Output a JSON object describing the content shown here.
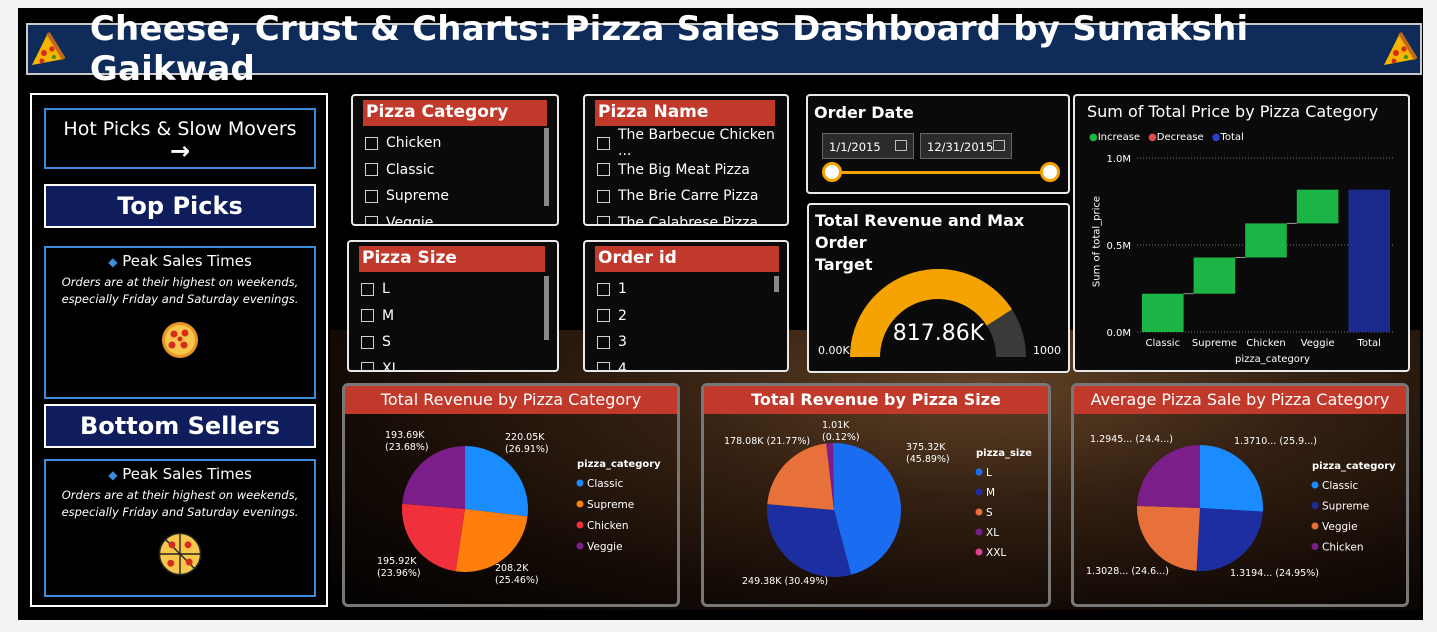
{
  "banner": {
    "title": "Cheese, Crust & Charts: Pizza Sales Dashboard by Sunakshi Gaikwad",
    "left_icon": "pizza-slice-icon",
    "right_icon": "pizza-slice-icon"
  },
  "left_panel": {
    "nav_button": {
      "label": "Hot Picks & Slow Movers",
      "arrow": "→",
      "icon": "arrow-right-icon"
    },
    "top_picks": {
      "title": "Top Picks",
      "info_title": "Peak Sales Times",
      "info_text_1": "Orders are at their highest on weekends,",
      "info_text_2": "especially Friday and Saturday evenings.",
      "icon": "pizza-icon"
    },
    "bottom_sellers": {
      "title": "Bottom Sellers",
      "info_title": "Peak Sales Times",
      "info_text_1": "Orders are at their highest on weekends,",
      "info_text_2": "especially Friday and Saturday evenings.",
      "icon": "pizza-icon"
    }
  },
  "slicers": {
    "category": {
      "title": "Pizza Category",
      "items": [
        "Chicken",
        "Classic",
        "Supreme",
        "Veggie"
      ]
    },
    "name": {
      "title": "Pizza Name",
      "items": [
        "The Barbecue Chicken ...",
        "The Big Meat Pizza",
        "The Brie Carre Pizza",
        "The Calabrese Pizza"
      ]
    },
    "size": {
      "title": "Pizza Size",
      "items": [
        "L",
        "M",
        "S",
        "XL"
      ]
    },
    "order_id": {
      "title": "Order id",
      "items": [
        "1",
        "2",
        "3",
        "4"
      ]
    }
  },
  "order_date": {
    "title": "Order Date",
    "start": "1/1/2015",
    "end": "12/31/2015",
    "icon": "calendar-icon"
  },
  "gauge": {
    "title_1": "Total Revenue and Max Order",
    "title_2": "Target",
    "value_label": "817.86K",
    "min_label": "0.00K",
    "max_label": "1000",
    "value": 817.86,
    "max": 1000,
    "color": "#f5a300"
  },
  "waterfall": {
    "title": "Sum of Total Price by Pizza Category",
    "legend": [
      {
        "label": "Increase",
        "color": "#1db446"
      },
      {
        "label": "Decrease",
        "color": "#e04a4a"
      },
      {
        "label": "Total",
        "color": "#1b2a8c"
      }
    ],
    "ylabel": "Sum of total_price",
    "xlabel": "pizza_category",
    "yticks": [
      "1.0M",
      "0.5M",
      "0.0M"
    ],
    "categories": [
      "Classic",
      "Supreme",
      "Chicken",
      "Veggie",
      "Total"
    ]
  },
  "pie_category": {
    "title": "Total Revenue by Pizza Category",
    "legend_title": "pizza_category",
    "slices": [
      {
        "label": "Classic",
        "value": 220.05,
        "color": "#1a8cff",
        "l1": "220.05K",
        "l2": "(26.91%)"
      },
      {
        "label": "Supreme",
        "value": 208.2,
        "color": "#ff7f0e",
        "l1": "208.2K",
        "l2": "(25.46%)"
      },
      {
        "label": "Chicken",
        "value": 195.92,
        "color": "#f0303a",
        "l1": "195.92K",
        "l2": "(23.96%)"
      },
      {
        "label": "Veggie",
        "value": 193.69,
        "color": "#7b1e8a",
        "l1": "193.69K",
        "l2": "(23.68%)"
      }
    ]
  },
  "pie_size": {
    "title": "Total Revenue by Pizza Size",
    "legend_title": "pizza_size",
    "slices": [
      {
        "label": "L",
        "value": 375.32,
        "color": "#1a6cf0",
        "l1": "375.32K",
        "l2": "(45.89%)"
      },
      {
        "label": "M",
        "value": 249.38,
        "color": "#1c2ea0",
        "l1": "249.38K (30.49%)",
        "l2": ""
      },
      {
        "label": "S",
        "value": 178.08,
        "color": "#e8703a",
        "l1": "178.08K (21.77%)",
        "l2": ""
      },
      {
        "label": "XL",
        "value": 14.05,
        "color": "#7b1e8a",
        "l1": "",
        "l2": ""
      },
      {
        "label": "XXL",
        "value": 1.01,
        "color": "#e0409a",
        "l1": "1.01K",
        "l2": "(0.12%)"
      }
    ]
  },
  "pie_avg": {
    "title": "Average Pizza Sale by Pizza Category",
    "legend_title": "pizza_category",
    "slices": [
      {
        "label": "Classic",
        "value": 1.371,
        "color": "#1a8cff",
        "l1": "1.3710... (25.9...)",
        "l2": ""
      },
      {
        "label": "Supreme",
        "value": 1.3194,
        "color": "#1c2ea0",
        "l1": "1.3194... (24.95%)",
        "l2": ""
      },
      {
        "label": "Veggie",
        "value": 1.3028,
        "color": "#e8703a",
        "l1": "1.3028... (24.6...)",
        "l2": ""
      },
      {
        "label": "Chicken",
        "value": 1.2945,
        "color": "#7b1e8a",
        "l1": "1.2945... (24.4...)",
        "l2": ""
      }
    ]
  },
  "chart_data": [
    {
      "type": "bar",
      "title": "Sum of Total Price by Pizza Category",
      "categories": [
        "Classic",
        "Supreme",
        "Chicken",
        "Veggie",
        "Total"
      ],
      "values": [
        220053.1,
        208197,
        195919.5,
        193690.45,
        817860.05
      ],
      "xlabel": "pizza_category",
      "ylabel": "Sum of total_price",
      "ylim": [
        0,
        1000000
      ],
      "grid": true,
      "legend": "top-left"
    },
    {
      "type": "pie",
      "title": "Total Revenue by Pizza Category",
      "categories": [
        "Classic",
        "Supreme",
        "Chicken",
        "Veggie"
      ],
      "values": [
        220.05,
        208.2,
        195.92,
        193.69
      ],
      "legend": "right"
    },
    {
      "type": "pie",
      "title": "Total Revenue by Pizza Size",
      "categories": [
        "L",
        "M",
        "S",
        "XL",
        "XXL"
      ],
      "values": [
        375.32,
        249.38,
        178.08,
        14.05,
        1.01
      ],
      "legend": "right"
    },
    {
      "type": "pie",
      "title": "Average Pizza Sale by Pizza Category",
      "categories": [
        "Classic",
        "Supreme",
        "Veggie",
        "Chicken"
      ],
      "values": [
        1.371,
        1.3194,
        1.3028,
        1.2945
      ],
      "legend": "right"
    }
  ]
}
